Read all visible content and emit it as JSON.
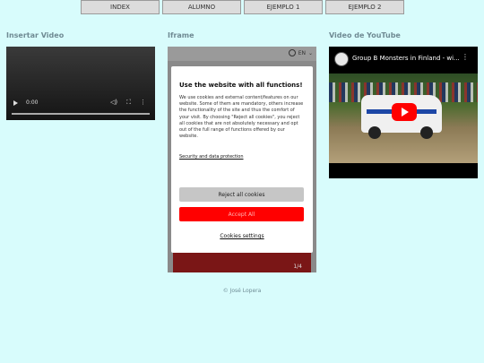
{
  "nav": {
    "items": [
      {
        "label": "INDEX"
      },
      {
        "label": "ALUMNO"
      },
      {
        "label": "EJEMPLO 1"
      },
      {
        "label": "EJEMPLO 2"
      }
    ]
  },
  "columns": {
    "video": {
      "title": "Insertar Video",
      "player": {
        "time": "0:00"
      }
    },
    "iframe": {
      "title": "Iframe",
      "language": "EN",
      "pager": "1/4",
      "cookie_modal": {
        "heading": "Use the website with all functions!",
        "body": "We use cookies and external content/features on our website. Some of them are mandatory, others increase the functionality of the site and thus the comfort of your visit. By choosing \"Reject all cookies\", you reject all cookies that are not absolutely necessary and opt out of the full range of functions offered by our website.",
        "privacy_link": "Security and data protection",
        "reject_label": "Reject all cookies",
        "accept_label": "Accept All",
        "settings_label": "Cookies settings"
      }
    },
    "youtube": {
      "title": "Video de YouTube",
      "video_title": "Group B Monsters in Finland - wi..."
    }
  },
  "footer": {
    "text": "© José Lopera"
  },
  "colors": {
    "background": "#d8fcfc",
    "accent_red": "#ff0000",
    "title": "#6f8a93"
  }
}
